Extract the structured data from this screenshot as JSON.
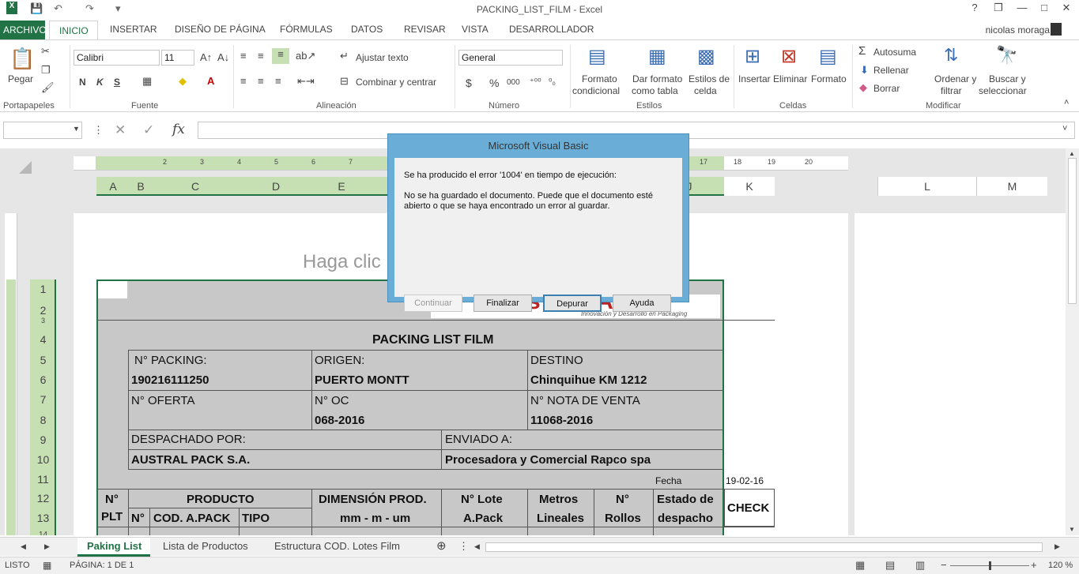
{
  "window": {
    "title": "PACKING_LIST_FILM - Excel",
    "help": "?",
    "restore": "❐",
    "minimize": "—",
    "maximize": "□",
    "close": "✕"
  },
  "quick_access": {
    "undo": "↶",
    "redo": "↷",
    "customize": "▾"
  },
  "tabs": [
    "ARCHIVO",
    "INICIO",
    "INSERTAR",
    "DISEÑO DE PÁGINA",
    "FÓRMULAS",
    "DATOS",
    "REVISAR",
    "VISTA",
    "DESARROLLADOR"
  ],
  "user": "nicolas moraga",
  "ribbon": {
    "portapapeles": {
      "label": "Portapapeles",
      "pegar": "Pegar"
    },
    "fuente": {
      "label": "Fuente",
      "font": "Calibri",
      "size": "11",
      "bold": "N",
      "italic": "K",
      "underline": "S"
    },
    "alineacion": {
      "label": "Alineación",
      "wrap": "Ajustar texto",
      "merge": "Combinar y centrar"
    },
    "numero": {
      "label": "Número",
      "format": "General",
      "currency": "$",
      "percent": "%",
      "thousands": "000",
      "inc_dec": "⁺⁰⁰",
      "dec_dec": "⁰₀"
    },
    "estilos": {
      "label": "Estilos",
      "cond_1": "Formato",
      "cond_2": "condicional",
      "table_1": "Dar formato",
      "table_2": "como tabla",
      "cell_1": "Estilos de",
      "cell_2": "celda"
    },
    "celdas": {
      "label": "Celdas",
      "insert": "Insertar",
      "delete": "Eliminar",
      "format": "Formato"
    },
    "modificar": {
      "label": "Modificar",
      "autosum": "Autosuma",
      "fill": "Rellenar",
      "clear": "Borrar",
      "sort_1": "Ordenar y",
      "sort_2": "filtrar",
      "find_1": "Buscar y",
      "find_2": "seleccionar"
    }
  },
  "formula_bar": {
    "name_box": "",
    "fx": "fx",
    "cancel": "✕",
    "enter": "✓",
    "value": ""
  },
  "ruler_numbers": [
    "1",
    "2",
    "3",
    "4",
    "5",
    "6",
    "7",
    "8",
    "17",
    "18",
    "19",
    "20"
  ],
  "columns": [
    "A",
    "B",
    "C",
    "D",
    "E",
    "J",
    "K",
    "L",
    "M"
  ],
  "rows": [
    "1",
    "2",
    "3",
    "4",
    "5",
    "6",
    "7",
    "8",
    "9",
    "10",
    "11",
    "12",
    "13",
    "14"
  ],
  "header_placeholder": "Haga clic",
  "logo": {
    "name": "AustralPACK",
    "tagline": "Innovación y Desarrollo en Packaging"
  },
  "sheet": {
    "title": "PACKING LIST FILM",
    "packing_label": "N° PACKING:",
    "packing_value": "190216111250",
    "origen_label": "ORIGEN:",
    "origen_value": "PUERTO MONTT",
    "destino_label": "DESTINO",
    "destino_value": "Chinquihue KM 1212",
    "oferta_label": "N° OFERTA",
    "oc_label": "N° OC",
    "oc_value": "068-2016",
    "nota_label": "N° NOTA DE VENTA",
    "nota_value": "11068-2016",
    "despachado_label": "DESPACHADO POR:",
    "despachado_value": "AUSTRAL PACK S.A.",
    "enviado_label": "ENVIADO A:",
    "enviado_value": "Procesadora y Comercial Rapco spa",
    "fecha_label": "Fecha",
    "fecha_value": "19-02-16",
    "headers": {
      "plt_1": "N°",
      "plt_2": "PLT",
      "producto": "PRODUCTO",
      "no": "N°",
      "cod": "COD. A.PACK",
      "tipo": "TIPO",
      "dim_1": "DIMENSIÓN PROD.",
      "dim_2": "mm - m - um",
      "lote_1": "N° Lote",
      "lote_2": "A.Pack",
      "metros_1": "Metros",
      "metros_2": "Lineales",
      "rollos_1": "N°",
      "rollos_2": "Rollos",
      "estado_1": "Estado de",
      "estado_2": "despacho",
      "check": "CHECK"
    }
  },
  "dialog": {
    "title": "Microsoft Visual Basic",
    "line1": "Se ha producido el error '1004' en tiempo de ejecución:",
    "line2": "No se ha guardado el documento. Puede que el documento esté",
    "line3": "abierto o que se haya encontrado un error al guardar.",
    "buttons": [
      "Continuar",
      "Finalizar",
      "Depurar",
      "Ayuda"
    ]
  },
  "sheet_tabs": [
    "Paking List",
    "Lista de Productos",
    "Estructura COD. Lotes Film"
  ],
  "add_sheet": "⊕",
  "status": {
    "mode": "LISTO",
    "page": "PÁGINA: 1 DE 1",
    "zoom": "120 %",
    "zoom_minus": "−",
    "zoom_plus": "+"
  }
}
